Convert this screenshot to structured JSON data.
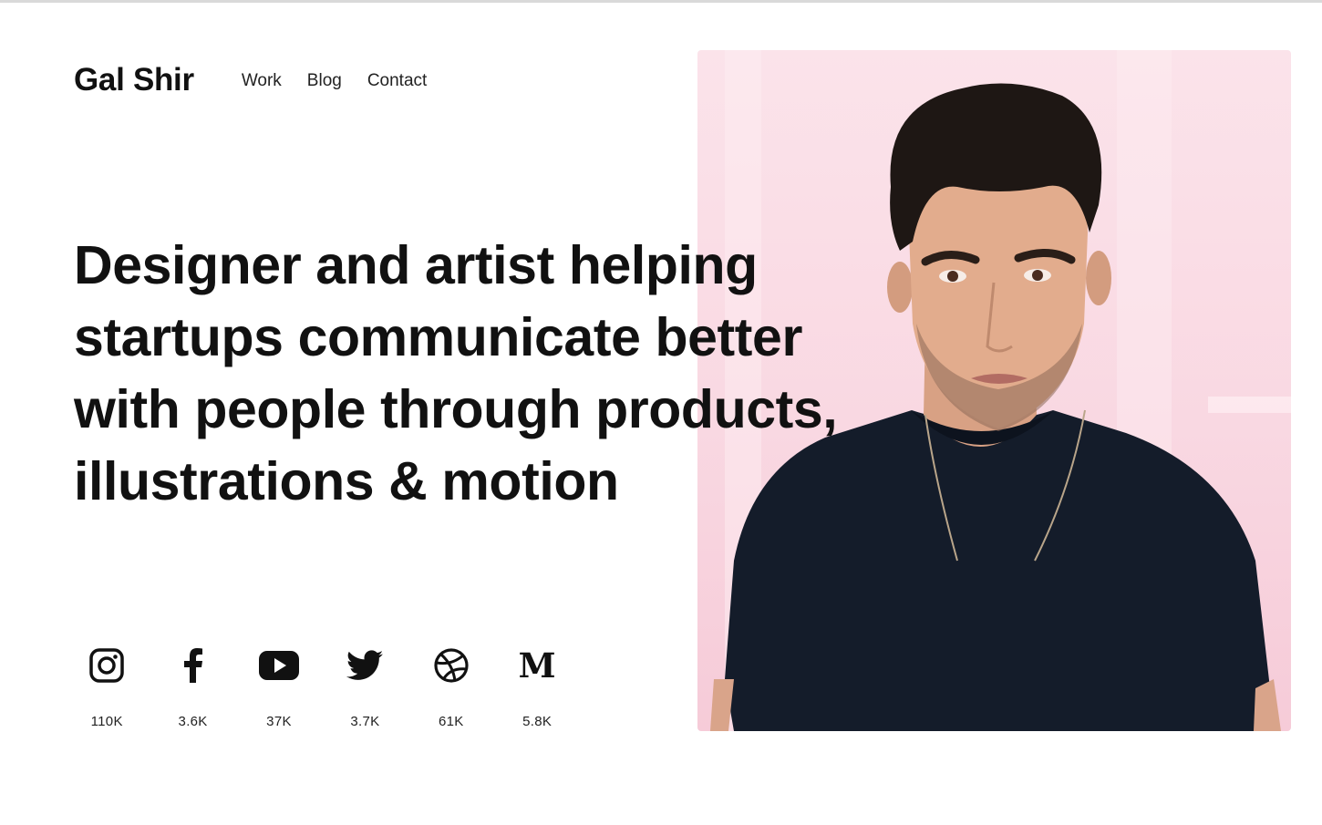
{
  "header": {
    "logo": "Gal Shir",
    "nav": [
      {
        "label": "Work"
      },
      {
        "label": "Blog"
      },
      {
        "label": "Contact"
      }
    ]
  },
  "hero": {
    "lines": [
      "Designer and artist helping",
      "startups communicate better",
      "with people through products,",
      "illustrations & motion"
    ]
  },
  "socials": [
    {
      "icon": "instagram-icon",
      "count": "110K"
    },
    {
      "icon": "facebook-icon",
      "count": "3.6K"
    },
    {
      "icon": "youtube-icon",
      "count": "37K"
    },
    {
      "icon": "twitter-icon",
      "count": "3.7K"
    },
    {
      "icon": "dribbble-icon",
      "count": "61K"
    },
    {
      "icon": "medium-icon",
      "count": "5.8K",
      "glyph": "M"
    }
  ],
  "colors": {
    "text": "#111111",
    "portrait_background": "#f9d8e2",
    "shirt": "#141c2a"
  }
}
